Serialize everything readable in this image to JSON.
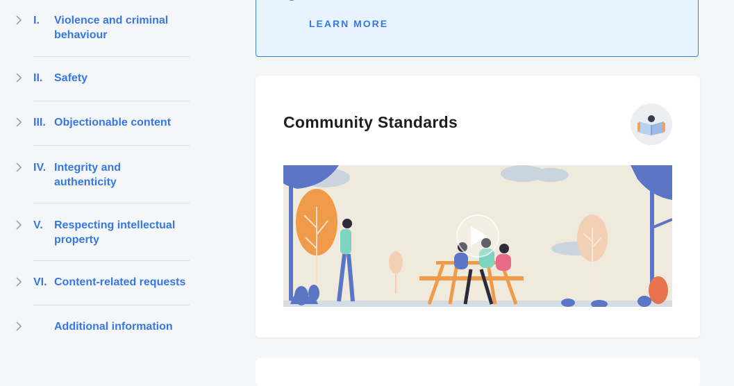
{
  "sidebar": {
    "items": [
      {
        "num": "I.",
        "label": "Violence and criminal behaviour"
      },
      {
        "num": "II.",
        "label": "Safety"
      },
      {
        "num": "III.",
        "label": "Objectionable content"
      },
      {
        "num": "IV.",
        "label": "Integrity and authenticity"
      },
      {
        "num": "V.",
        "label": "Respecting intellectual property"
      },
      {
        "num": "VI.",
        "label": "Content-related requests"
      },
      {
        "num": "",
        "label": "Additional information"
      }
    ]
  },
  "banner": {
    "learn_more": "LEARN MORE"
  },
  "card": {
    "title": "Community Standards",
    "video_icon": "play-icon"
  },
  "colors": {
    "link_blue": "#3578e5",
    "banner_bg": "#e7f3ff",
    "banner_border": "#3b82c4",
    "illustration_bg": "#efeadb"
  }
}
